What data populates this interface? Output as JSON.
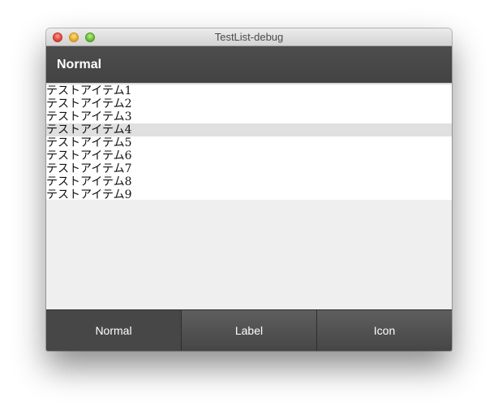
{
  "window": {
    "title": "TestList-debug"
  },
  "appbar": {
    "title": "Normal"
  },
  "list": {
    "items": [
      "テストアイテム1",
      "テストアイテム2",
      "テストアイテム3",
      "テストアイテム4",
      "テストアイテム5",
      "テストアイテム6",
      "テストアイテム7",
      "テストアイテム8",
      "テストアイテム9"
    ],
    "selected_index": 3
  },
  "tabs": [
    {
      "label": "Normal",
      "active": true
    },
    {
      "label": "Label",
      "active": false
    },
    {
      "label": "Icon",
      "active": false
    }
  ],
  "colors": {
    "appbar": "#474747",
    "selected_row": "#e0e0e0",
    "tabbar": "#4f4f4f"
  }
}
